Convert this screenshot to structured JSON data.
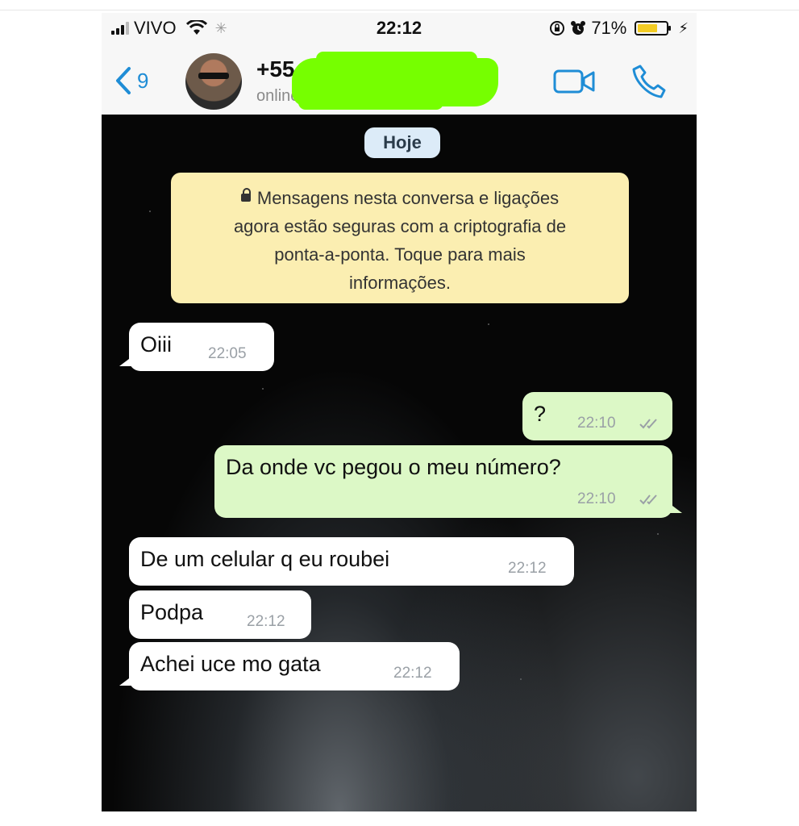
{
  "status_bar": {
    "carrier": "VIVO",
    "time": "22:12",
    "battery_percent": "71%",
    "battery_level": 0.71
  },
  "nav": {
    "back_count": "9",
    "contact_name": "+55",
    "contact_status": "online"
  },
  "chat": {
    "date_chip": "Hoje",
    "encryption_notice": [
      "Mensagens nesta conversa e ligações",
      "agora estão seguras com a criptografia de",
      "ponta-a-ponta. Toque para mais",
      "informações."
    ],
    "messages": [
      {
        "direction": "in",
        "text": "Oiii",
        "time": "22:05"
      },
      {
        "direction": "out",
        "text": "?",
        "time": "22:10"
      },
      {
        "direction": "out",
        "text": "Da onde vc pegou o meu número?",
        "time": "22:10"
      },
      {
        "direction": "in",
        "text": "De um celular q eu roubei",
        "time": "22:12"
      },
      {
        "direction": "in",
        "text": "Podpa",
        "time": "22:12"
      },
      {
        "direction": "in",
        "text": "Achei uce mo gata",
        "time": "22:12"
      }
    ]
  },
  "colors": {
    "accent": "#1f8dd6",
    "incoming_bubble": "#ffffff",
    "outgoing_bubble": "#dcf8c6",
    "notice_bg": "#fbeeb1",
    "redaction": "#76ff00"
  },
  "icons": [
    "signal-icon",
    "wifi-icon",
    "activity-spinner-icon",
    "rotation-lock-icon",
    "alarm-icon",
    "battery-icon",
    "charging-icon",
    "back-chevron-icon",
    "video-call-icon",
    "phone-call-icon",
    "lock-icon",
    "read-ticks-icon"
  ]
}
